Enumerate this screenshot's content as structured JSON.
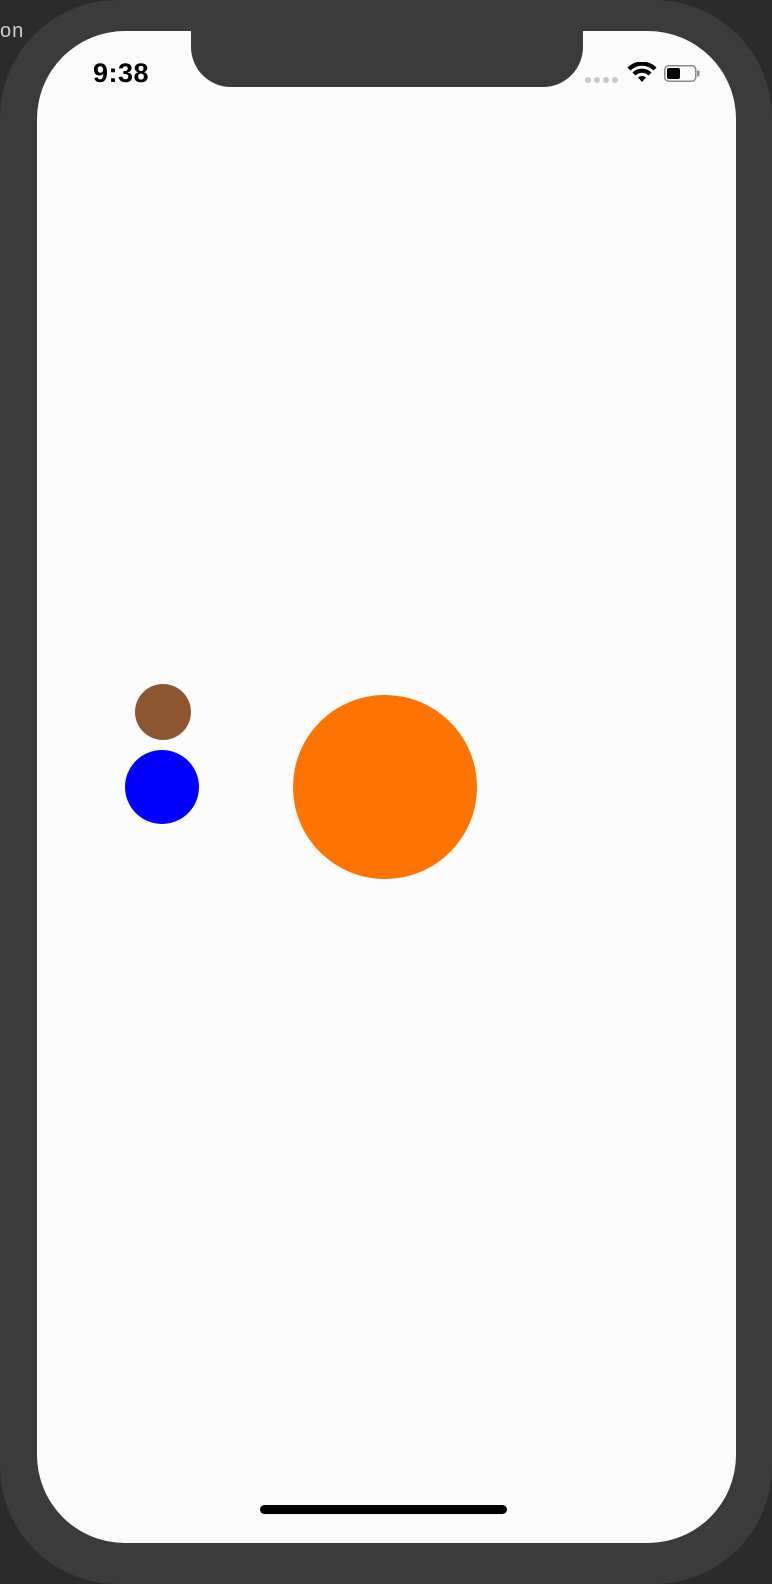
{
  "backdrop": {
    "text": "on"
  },
  "status_bar": {
    "time": "9:38",
    "wifi_icon": "wifi-icon",
    "battery_icon": "battery-icon"
  },
  "colors": {
    "frame": "#3b3b3b",
    "screen": "#fcfcfc",
    "brown": "#8b5630",
    "blue": "#0000ff",
    "orange": "#ff7400"
  },
  "shapes": [
    {
      "name": "brown-circle",
      "color": "#8b5630"
    },
    {
      "name": "blue-circle",
      "color": "#0000ff"
    },
    {
      "name": "orange-circle",
      "color": "#ff7400"
    }
  ]
}
